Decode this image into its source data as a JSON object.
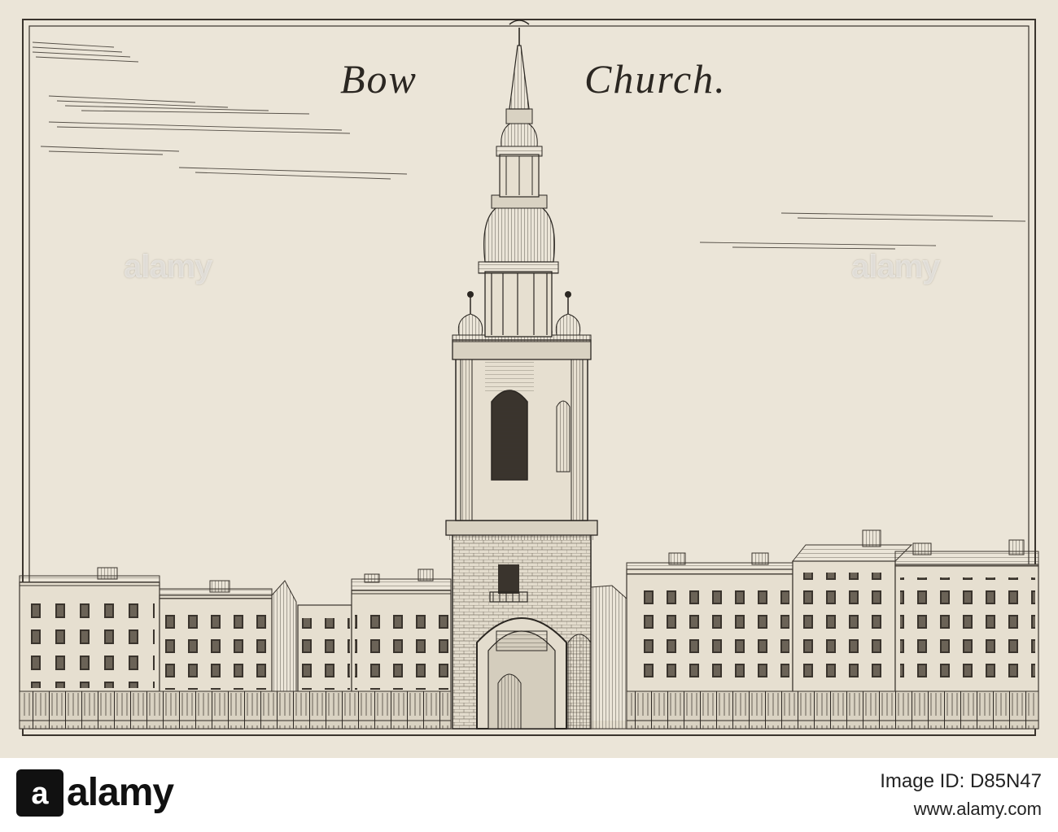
{
  "engraving": {
    "title_left": "Bow",
    "title_right": "Church.",
    "colors": {
      "paper": "#ebe5d8",
      "ink": "#3a342d"
    }
  },
  "watermark": {
    "text": "alamy",
    "left": "alamy",
    "right": "alamy"
  },
  "footer": {
    "logo_text": "alamy",
    "image_id": "Image ID: D85N47",
    "url": "www.alamy.com"
  }
}
